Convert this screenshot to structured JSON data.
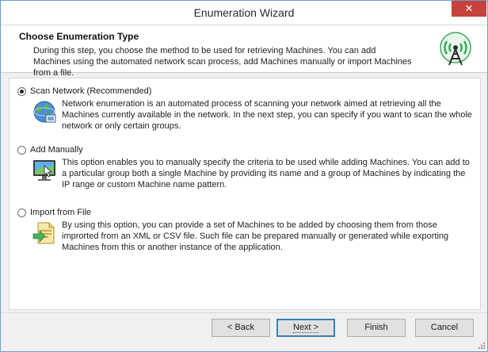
{
  "window": {
    "title": "Enumeration Wizard",
    "close_glyph": "✕"
  },
  "header": {
    "title": "Choose Enumeration Type",
    "description": "During this step, you choose the method to be used for retrieving Machines. You can add Machines using the automated network scan process, add Machines manually or import Machines from a file.",
    "icon": "antenna-icon"
  },
  "options": [
    {
      "label": "Scan Network (Recommended)",
      "selected": true,
      "icon": "globe-network-icon",
      "description": "Network enumeration is an automated process of scanning your network aimed at retrieving all the Machines currently available in the network. In the next step, you can specify if you want to scan the whole network or only certain groups."
    },
    {
      "label": "Add Manually",
      "selected": false,
      "icon": "monitor-cursor-icon",
      "description": "This option enables you to manually specify the criteria to be used while adding Machines. You can add to a particular group both a single Machine by providing its name and a group of Machines by indicating the IP range or custom Machine name pattern."
    },
    {
      "label": "Import from File",
      "selected": false,
      "icon": "import-file-icon",
      "description": "By using this option, you can provide a set of Machines to be added by choosing them from those improrted from an XML or CSV file. Such file can be prepared manually or generated while exporting Machines from this or another instance of the application."
    }
  ],
  "buttons": {
    "back": "< Back",
    "next": "Next >",
    "finish": "Finish",
    "cancel": "Cancel"
  },
  "colors": {
    "accent": "#3c7fb1",
    "close": "#c7413a",
    "antenna": "#3aa85a"
  }
}
